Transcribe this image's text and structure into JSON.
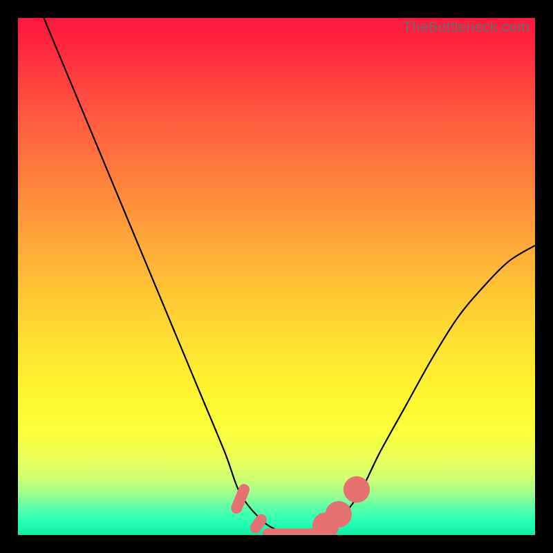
{
  "watermark": "TheBottleneck.com",
  "chart_data": {
    "type": "line",
    "title": "",
    "xlabel": "",
    "ylabel": "",
    "xlim": [
      0,
      100
    ],
    "ylim": [
      0,
      100
    ],
    "grid": false,
    "legend": false,
    "series": [
      {
        "name": "bottleneck-curve",
        "x": [
          5,
          10,
          15,
          20,
          25,
          30,
          35,
          40,
          43,
          47,
          50,
          53,
          56,
          58,
          62,
          66,
          70,
          75,
          80,
          85,
          90,
          95,
          100
        ],
        "y": [
          100,
          88,
          76,
          64,
          52,
          40,
          28,
          16,
          8,
          3,
          1,
          0,
          0,
          1,
          3,
          8,
          16,
          25,
          34,
          42,
          48,
          53,
          56
        ]
      }
    ],
    "markers": [
      {
        "shape": "capsule",
        "x": 43.0,
        "y": 7.0,
        "len": 6.0,
        "angle": -68
      },
      {
        "shape": "capsule",
        "x": 46.5,
        "y": 2.2,
        "len": 4.0,
        "angle": -55
      },
      {
        "shape": "capsule",
        "x": 52.5,
        "y": 0.2,
        "len": 10.5,
        "angle": 0
      },
      {
        "shape": "dot",
        "x": 59.5,
        "y": 1.8,
        "r": 1.6
      },
      {
        "shape": "dot",
        "x": 62.0,
        "y": 4.0,
        "r": 1.6
      },
      {
        "shape": "dot",
        "x": 65.5,
        "y": 8.8,
        "r": 1.6
      }
    ],
    "background": "rainbow-vertical-gradient"
  }
}
